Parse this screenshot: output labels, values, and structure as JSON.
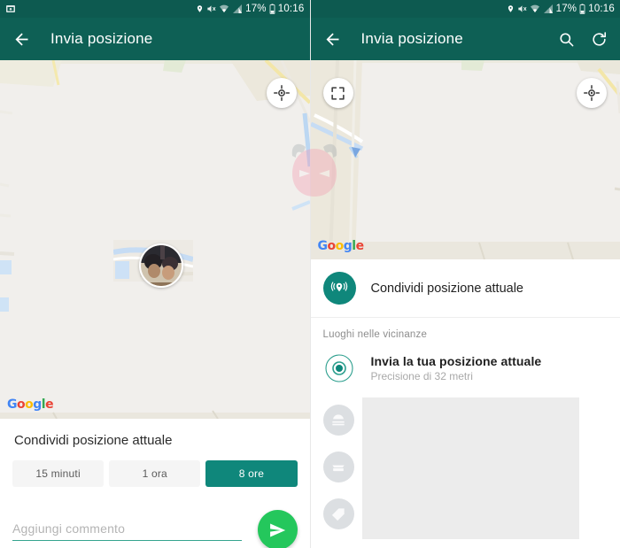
{
  "app": {
    "title": "Invia posizione"
  },
  "status_bar": {
    "icons": [
      "screenshot-icon",
      "location-icon",
      "mute-icon",
      "wifi-icon",
      "signal-icon"
    ],
    "battery": "17%",
    "time": "10:16"
  },
  "left_panel": {
    "appbar": {
      "back": "back-arrow-icon",
      "title": "Invia posizione"
    },
    "map": {
      "locate_button": "locate-icon",
      "google_logo": "Google",
      "avatar_marker": "user-avatar"
    },
    "sheet": {
      "title": "Condividi posizione attuale",
      "durations": [
        {
          "label": "15 minuti",
          "selected": false
        },
        {
          "label": "1 ora",
          "selected": false
        },
        {
          "label": "8 ore",
          "selected": true
        }
      ],
      "comment_placeholder": "Aggiungi commento",
      "comment_value": "",
      "send_button": "send-icon"
    }
  },
  "right_panel": {
    "appbar": {
      "back": "back-arrow-icon",
      "title": "Invia posizione",
      "search": "search-icon",
      "refresh": "refresh-icon"
    },
    "map": {
      "expand_button": "fullscreen-icon",
      "locate_button": "locate-icon",
      "google_logo": "Google"
    },
    "list": {
      "share_row": {
        "icon": "live-location-icon",
        "label": "Condividi posizione attuale"
      },
      "section_label": "Luoghi nelle vicinanze",
      "send_row": {
        "icon": "target-icon",
        "title": "Invia la tua posizione attuale",
        "subtitle": "Precisione di 32 metri"
      },
      "placeholder_rows": [
        {
          "icon": "restaurant-icon"
        },
        {
          "icon": "store-icon"
        },
        {
          "icon": "tag-icon"
        }
      ]
    }
  },
  "watermark": {
    "label": "devil-head-watermark"
  },
  "colors": {
    "status_bar": "#0d5a50",
    "app_bar": "#0e6055",
    "accent_teal": "#0f877b",
    "send_green": "#24c75c",
    "underline_teal": "#35a48f",
    "map_bg": "#f0eeeb"
  }
}
